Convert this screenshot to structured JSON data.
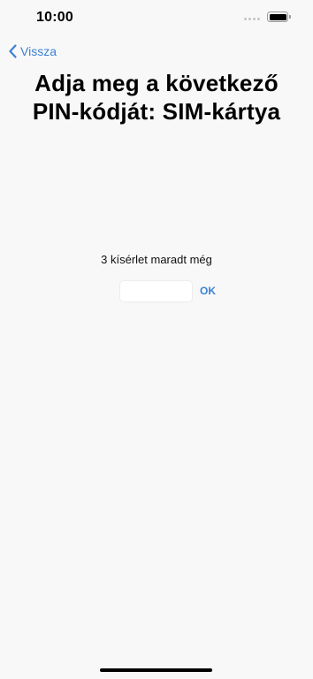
{
  "status_bar": {
    "time": "10:00",
    "signal_icon": "signal-dots-icon",
    "battery_icon": "battery-icon"
  },
  "nav": {
    "back_label": "Vissza",
    "back_icon": "chevron-left-icon",
    "accent_color": "#3c82d2"
  },
  "title": {
    "line1": "Adja meg a következő",
    "line2": "PIN-kódját: SIM-kártya"
  },
  "pin": {
    "attempts_text": "3 kísérlet maradt még",
    "input_value": "",
    "ok_label": "OK"
  }
}
